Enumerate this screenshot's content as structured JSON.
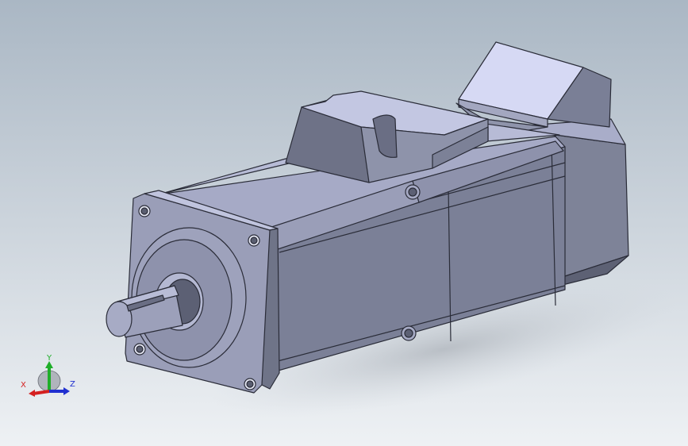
{
  "viewport": {
    "background_top": "#aab7c4",
    "background_bottom": "#eef1f4",
    "model_color": "#8a8fa6"
  },
  "triad": {
    "x_label": "X",
    "y_label": "Y",
    "z_label": "Z",
    "x_color": "#d42020",
    "y_color": "#1fae2a",
    "z_color": "#2030d0"
  }
}
